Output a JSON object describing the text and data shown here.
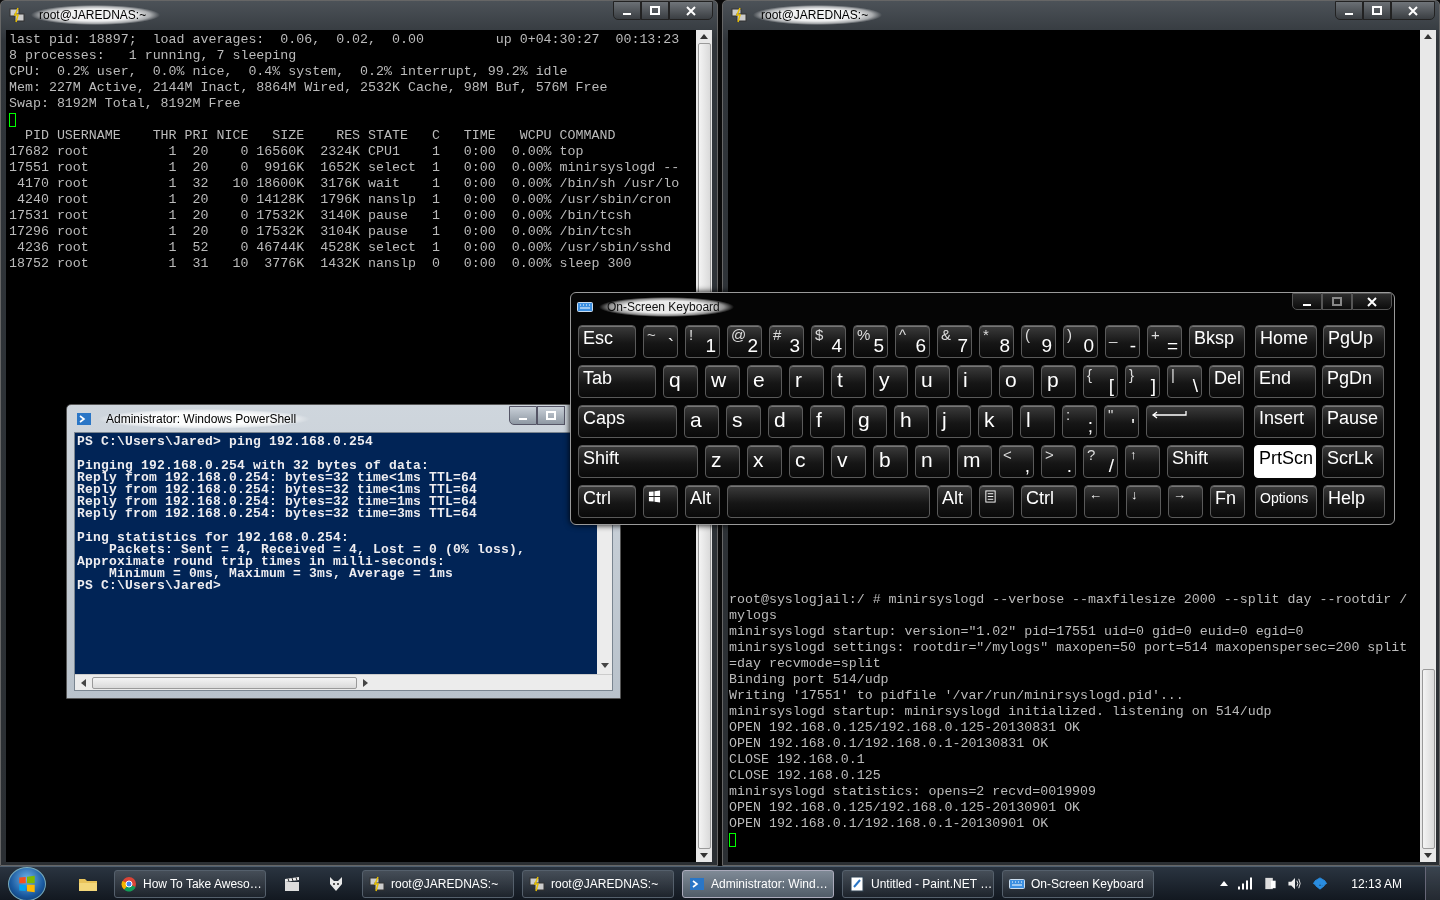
{
  "putty_left": {
    "title": "root@JAREDNAS:~",
    "summary": [
      "last pid: 18897;  load averages:  0.06,  0.02,  0.00         up 0+04:30:27  00:13:23",
      "8 processes:   1 running, 7 sleeping",
      "CPU:  0.2% user,  0.0% nice,  0.4% system,  0.2% interrupt, 99.2% idle",
      "Mem: 227M Active, 2144M Inact, 8864M Wired, 2532K Cache, 98M Buf, 576M Free",
      "Swap: 8192M Total, 8192M Free"
    ],
    "table_header": "  PID USERNAME    THR PRI NICE   SIZE    RES STATE   C   TIME   WCPU COMMAND",
    "table_rows": [
      "17682 root          1  20    0 16560K  2324K CPU1    1   0:00  0.00% top",
      "17551 root          1  20    0  9916K  1652K select  1   0:00  0.00% minirsyslogd --",
      " 4170 root          1  32   10 18600K  3176K wait    1   0:00  0.00% /bin/sh /usr/lo",
      " 4240 root          1  20    0 14128K  1796K nanslp  1   0:00  0.00% /usr/sbin/cron",
      "17531 root          1  20    0 17532K  3140K pause   1   0:00  0.00% /bin/tcsh",
      "17296 root          1  20    0 17532K  3104K pause   1   0:00  0.00% /bin/tcsh",
      " 4236 root          1  52    0 46744K  4528K select  1   0:00  0.00% /usr/sbin/sshd",
      "18752 root          1  31   10  3776K  1432K nanslp  0   0:00  0.00% sleep 300"
    ]
  },
  "putty_right": {
    "title": "root@JAREDNAS:~",
    "lines": [
      "root@syslogjail:/ # minirsyslogd --verbose --maxfilesize 2000 --split day --rootdir /",
      "mylogs",
      "minirsyslogd startup: version=\"1.02\" pid=17551 uid=0 gid=0 euid=0 egid=0",
      "minirsyslogd settings: rootdir=\"/mylogs\" maxopen=50 port=514 maxopenspersec=200 split",
      "=day recvmode=split",
      "Binding port 514/udp",
      "Writing '17551' to pidfile '/var/run/minirsyslogd.pid'...",
      "minirsyslogd startup: minirsyslogd initialized. listening on 514/udp",
      "OPEN 192.168.0.125/192.168.0.125-20130831 OK",
      "OPEN 192.168.0.1/192.168.0.1-20130831 OK",
      "CLOSE 192.168.0.1",
      "CLOSE 192.168.0.125",
      "minirsyslogd statistics: opens=2 recvd=0019909",
      "OPEN 192.168.0.125/192.168.0.125-20130901 OK",
      "OPEN 192.168.0.1/192.168.0.1-20130901 OK"
    ]
  },
  "powershell": {
    "title": "Administrator: Windows PowerShell",
    "blocks": [
      [
        "PS C:\\Users\\Jared> ping 192.168.0.254"
      ],
      [
        "Pinging 192.168.0.254 with 32 bytes of data:",
        "Reply from 192.168.0.254: bytes=32 time<1ms TTL=64",
        "Reply from 192.168.0.254: bytes=32 time<1ms TTL=64",
        "Reply from 192.168.0.254: bytes=32 time=1ms TTL=64",
        "Reply from 192.168.0.254: bytes=32 time=3ms TTL=64"
      ],
      [
        "Ping statistics for 192.168.0.254:",
        "    Packets: Sent = 4, Received = 4, Lost = 0 (0% loss),",
        "Approximate round trip times in milli-seconds:",
        "    Minimum = 0ms, Maximum = 3ms, Average = 1ms",
        "PS C:\\Users\\Jared>"
      ]
    ]
  },
  "keyboard": {
    "title": "On-Screen Keyboard",
    "rows": [
      {
        "keys": [
          {
            "kind": "named",
            "label": "Esc",
            "highlighted": false
          },
          {
            "kind": "symbol",
            "shift": "~",
            "label": "`",
            "highlighted": false
          },
          {
            "kind": "symbol",
            "shift": "!",
            "label": "1",
            "highlighted": false
          },
          {
            "kind": "symbol",
            "shift": "@",
            "label": "2",
            "highlighted": false
          },
          {
            "kind": "symbol",
            "shift": "#",
            "label": "3",
            "highlighted": false
          },
          {
            "kind": "symbol",
            "shift": "$",
            "label": "4",
            "highlighted": false
          },
          {
            "kind": "symbol",
            "shift": "%",
            "label": "5",
            "highlighted": false
          },
          {
            "kind": "symbol",
            "shift": "^",
            "label": "6",
            "highlighted": false
          },
          {
            "kind": "symbol",
            "shift": "&",
            "label": "7",
            "highlighted": false
          },
          {
            "kind": "symbol",
            "shift": "*",
            "label": "8",
            "highlighted": false
          },
          {
            "kind": "symbol",
            "shift": "(",
            "label": "9",
            "highlighted": false
          },
          {
            "kind": "symbol",
            "shift": ")",
            "label": "0",
            "highlighted": false
          },
          {
            "kind": "symbol",
            "shift": "_",
            "label": "-",
            "highlighted": false
          },
          {
            "kind": "symbol",
            "shift": "+",
            "label": "=",
            "highlighted": false
          },
          {
            "kind": "named",
            "label": "Bksp",
            "highlighted": false
          }
        ],
        "nav": [
          {
            "kind": "named",
            "label": "Home",
            "highlighted": false
          },
          {
            "kind": "named",
            "label": "PgUp",
            "highlighted": false
          }
        ]
      },
      {
        "keys": [
          {
            "kind": "named",
            "label": "Tab",
            "highlighted": false
          },
          {
            "kind": "letter",
            "label": "q",
            "highlighted": false
          },
          {
            "kind": "letter",
            "label": "w",
            "highlighted": false
          },
          {
            "kind": "letter",
            "label": "e",
            "highlighted": false
          },
          {
            "kind": "letter",
            "label": "r",
            "highlighted": false
          },
          {
            "kind": "letter",
            "label": "t",
            "highlighted": false
          },
          {
            "kind": "letter",
            "label": "y",
            "highlighted": false
          },
          {
            "kind": "letter",
            "label": "u",
            "highlighted": false
          },
          {
            "kind": "letter",
            "label": "i",
            "highlighted": false
          },
          {
            "kind": "letter",
            "label": "o",
            "highlighted": false
          },
          {
            "kind": "letter",
            "label": "p",
            "highlighted": false
          },
          {
            "kind": "symbol",
            "shift": "{",
            "label": "[",
            "highlighted": false
          },
          {
            "kind": "symbol",
            "shift": "}",
            "label": "]",
            "highlighted": false
          },
          {
            "kind": "symbol",
            "shift": "|",
            "label": "\\",
            "highlighted": false
          },
          {
            "kind": "named",
            "label": "Del",
            "highlighted": false
          }
        ],
        "nav": [
          {
            "kind": "named",
            "label": "End",
            "highlighted": false
          },
          {
            "kind": "named",
            "label": "PgDn",
            "highlighted": false
          }
        ]
      },
      {
        "keys": [
          {
            "kind": "named",
            "label": "Caps",
            "highlighted": false
          },
          {
            "kind": "letter",
            "label": "a",
            "highlighted": false
          },
          {
            "kind": "letter",
            "label": "s",
            "highlighted": false
          },
          {
            "kind": "letter",
            "label": "d",
            "highlighted": false
          },
          {
            "kind": "letter",
            "label": "f",
            "highlighted": false
          },
          {
            "kind": "letter",
            "label": "g",
            "highlighted": false
          },
          {
            "kind": "letter",
            "label": "h",
            "highlighted": false
          },
          {
            "kind": "letter",
            "label": "j",
            "highlighted": false
          },
          {
            "kind": "letter",
            "label": "k",
            "highlighted": false
          },
          {
            "kind": "letter",
            "label": "l",
            "highlighted": false
          },
          {
            "kind": "symbol",
            "shift": ":",
            "label": ";",
            "highlighted": false
          },
          {
            "kind": "symbol",
            "shift": "\"",
            "label": "'",
            "highlighted": false
          },
          {
            "kind": "enter",
            "highlighted": false
          }
        ],
        "nav": [
          {
            "kind": "named",
            "label": "Insert",
            "highlighted": false
          },
          {
            "kind": "named",
            "label": "Pause",
            "highlighted": false
          }
        ]
      },
      {
        "keys": [
          {
            "kind": "named",
            "label": "Shift",
            "highlighted": false
          },
          {
            "kind": "letter",
            "label": "z",
            "highlighted": false
          },
          {
            "kind": "letter",
            "label": "x",
            "highlighted": false
          },
          {
            "kind": "letter",
            "label": "c",
            "highlighted": false
          },
          {
            "kind": "letter",
            "label": "v",
            "highlighted": false
          },
          {
            "kind": "letter",
            "label": "b",
            "highlighted": false
          },
          {
            "kind": "letter",
            "label": "n",
            "highlighted": false
          },
          {
            "kind": "letter",
            "label": "m",
            "highlighted": false
          },
          {
            "kind": "symbol",
            "shift": "<",
            "label": ",",
            "highlighted": false
          },
          {
            "kind": "symbol",
            "shift": ">",
            "label": ".",
            "highlighted": false
          },
          {
            "kind": "symbol",
            "shift": "?",
            "label": "/",
            "highlighted": false
          },
          {
            "kind": "arrow",
            "label": "↑",
            "highlighted": false
          },
          {
            "kind": "named",
            "label": "Shift",
            "highlighted": false
          }
        ],
        "nav": [
          {
            "kind": "named",
            "label": "PrtScn",
            "highlighted": true
          },
          {
            "kind": "named",
            "label": "ScrLk",
            "highlighted": false
          }
        ]
      },
      {
        "keys": [
          {
            "kind": "named",
            "label": "Ctrl",
            "highlighted": false
          },
          {
            "kind": "windows",
            "highlighted": false
          },
          {
            "kind": "named",
            "label": "Alt",
            "highlighted": false
          },
          {
            "kind": "space",
            "highlighted": false
          },
          {
            "kind": "named",
            "label": "Alt",
            "highlighted": false
          },
          {
            "kind": "menu",
            "highlighted": false
          },
          {
            "kind": "named",
            "label": "Ctrl",
            "highlighted": false
          },
          {
            "kind": "arrow",
            "label": "←",
            "highlighted": false
          },
          {
            "kind": "arrow",
            "label": "↓",
            "highlighted": false
          },
          {
            "kind": "arrow",
            "label": "→",
            "highlighted": false
          },
          {
            "kind": "named",
            "label": "Fn",
            "highlighted": false
          }
        ],
        "nav": [
          {
            "kind": "small",
            "label": "Options",
            "highlighted": false
          },
          {
            "kind": "named",
            "label": "Help",
            "highlighted": false
          }
        ]
      }
    ]
  },
  "taskbar": {
    "tasks": [
      {
        "kind": "browser",
        "label": "How To Take Aweso…",
        "selected": false
      },
      {
        "kind": "putty",
        "label": "root@JAREDNAS:~",
        "selected": false
      },
      {
        "kind": "putty",
        "label": "root@JAREDNAS:~",
        "selected": false
      },
      {
        "kind": "powershell",
        "label": "Administrator: Wind…",
        "selected": true
      },
      {
        "kind": "paint",
        "label": "Untitled - Paint.NET …",
        "selected": false
      },
      {
        "kind": "keyboard",
        "label": "On-Screen Keyboard",
        "selected": false
      }
    ],
    "clock": "12:13 AM"
  }
}
